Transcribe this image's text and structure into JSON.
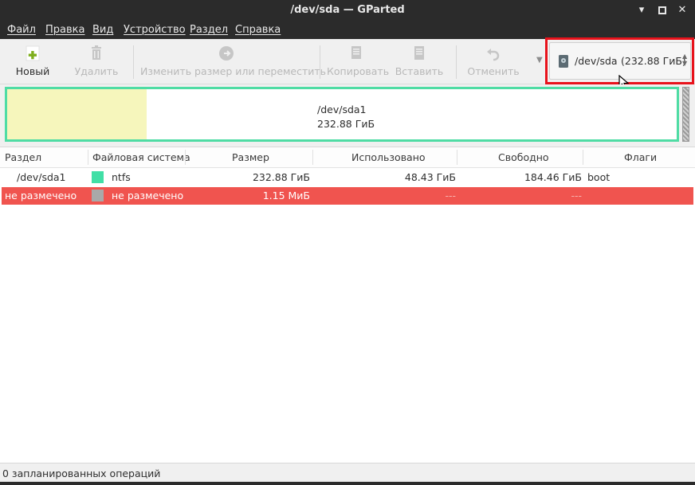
{
  "window": {
    "title": "/dev/sda — GParted",
    "minimize_glyph": "▾",
    "maximize_glyph": "▪",
    "close_glyph": "✕"
  },
  "menubar": {
    "items": [
      "Файл",
      "Правка",
      "Вид",
      "Устройство",
      "Раздел",
      "Справка"
    ]
  },
  "toolbar": {
    "buttons": [
      {
        "label": "Новый",
        "icon": "new-icon",
        "enabled": true
      },
      {
        "label": "Удалить",
        "icon": "delete-icon",
        "enabled": false
      },
      {
        "label": "Изменить размер или переместить",
        "icon": "resize-icon",
        "enabled": false
      },
      {
        "label": "Копировать",
        "icon": "copy-icon",
        "enabled": false
      },
      {
        "label": "Вставить",
        "icon": "paste-icon",
        "enabled": false
      },
      {
        "label": "Отменить",
        "icon": "undo-icon",
        "enabled": false
      }
    ],
    "overflow_glyph": "▼"
  },
  "device_selector": {
    "device": "/dev/sda",
    "size": "(232.88 ГиБ)",
    "spin_up": "▲",
    "spin_down": "▼",
    "highlight_color": "#e8121b"
  },
  "disk_map": {
    "partition_name": "/dev/sda1",
    "partition_size": "232.88 ГиБ",
    "used_fraction": 0.208,
    "border_color": "#4fdca4",
    "used_color": "#f6f6bc"
  },
  "table": {
    "columns": [
      "Раздел",
      "Файловая система",
      "Размер",
      "Использовано",
      "Свободно",
      "Флаги"
    ],
    "rows": [
      {
        "partition": "/dev/sda1",
        "filesystem": "ntfs",
        "fs_color": "#41dfa6",
        "size": "232.88 ГиБ",
        "used": "48.43 ГиБ",
        "free": "184.46 ГиБ",
        "flags": "boot",
        "selected": false
      },
      {
        "partition": "не размечено",
        "filesystem": "не размечено",
        "fs_color": "#a9a9a9",
        "size": "1.15 МиБ",
        "used": "---",
        "free": "---",
        "flags": "",
        "selected": true
      }
    ],
    "selected_color": "#f0544f"
  },
  "statusbar": {
    "text": "0 запланированных операций"
  }
}
